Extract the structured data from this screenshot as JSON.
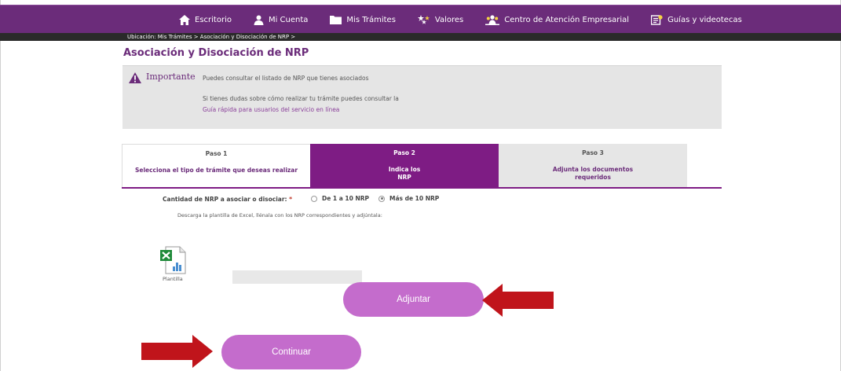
{
  "nav": {
    "items": [
      {
        "label": "Escritorio",
        "icon": "home-icon"
      },
      {
        "label": "Mi Cuenta",
        "icon": "user-icon"
      },
      {
        "label": "Mis Trámites",
        "icon": "folder-icon"
      },
      {
        "label": "Valores",
        "icon": "stars-icon"
      },
      {
        "label": "Centro de Atención Empresarial",
        "icon": "people-icon"
      },
      {
        "label": "Guías y videotecas",
        "icon": "guide-icon"
      }
    ]
  },
  "breadcrumb": "Ubicación: Mis Trámites > Asociación y Disociación de NRP >",
  "page_title": "Asociación y Disociación de NRP",
  "important": {
    "title": "Importante",
    "line1": "Puedes consultar el listado de NRP que tienes asociados",
    "line2": "Si tienes dudas sobre cómo realizar tu trámite puedes consultar la",
    "link": "Guía rápida para usuarios del servicio en línea"
  },
  "steps": [
    {
      "num": "Paso 1",
      "desc": "Selecciona el tipo de trámite que deseas realizar"
    },
    {
      "num": "Paso 2",
      "desc_line1": "Indica los",
      "desc_line2": "NRP"
    },
    {
      "num": "Paso 3",
      "desc_line1": "Adjunta los documentos",
      "desc_line2": "requeridos"
    }
  ],
  "form": {
    "qty_label": "Cantidad de NRP a asociar o disociar:",
    "required_mark": "*",
    "option1": "De 1 a 10 NRP",
    "option2": "Más de 10 NRP",
    "selected": "Más de 10 NRP",
    "download_text": "Descarga la plantilla de Excel, llénala con los NRP correspondientes y adjúntala:",
    "template_label": "Plantilla",
    "file_value": ""
  },
  "buttons": {
    "adjuntar": "Adjuntar",
    "continuar": "Continuar"
  },
  "colors": {
    "brand_purple": "#6b2c7a",
    "step_active": "#7e1c84",
    "button": "#c46ccc",
    "arrow": "#c0141b"
  }
}
